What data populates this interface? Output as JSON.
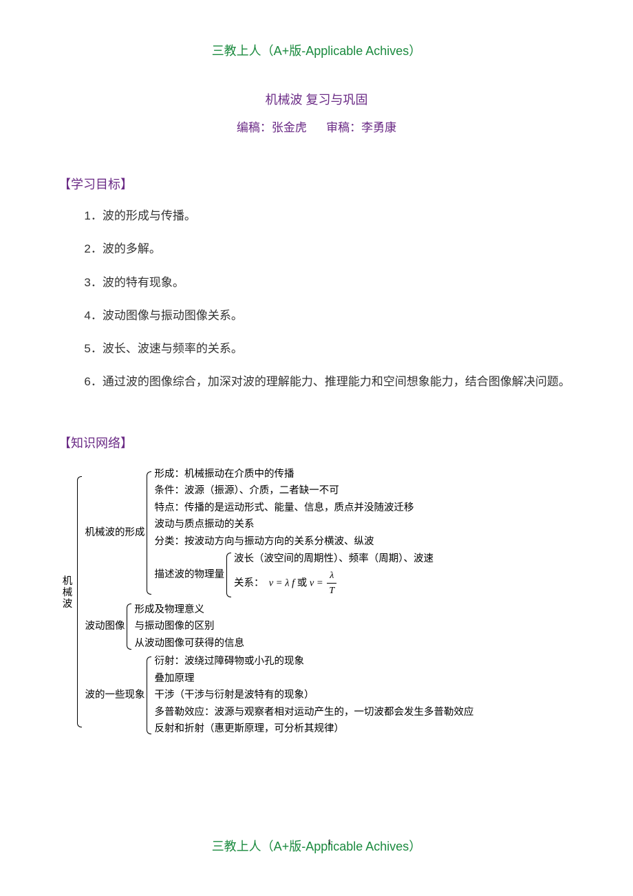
{
  "header": {
    "mark": "三教上人（A+版-Applicable Achives）"
  },
  "footer": {
    "mark_prefix": "三教上人（A+版-App",
    "mark_suffix": "licable Achives）",
    "page_num": "1"
  },
  "title": "机械波 复习与巩固",
  "author": {
    "label1": "编稿：",
    "name1": "张金虎",
    "label2": "审稿：",
    "name2": "李勇康"
  },
  "section_goals_head": "【学习目标】",
  "goals": {
    "g1": "1．波的形成与传播。",
    "g2": "2．波的多解。",
    "g3": "3．波的特有现象。",
    "g4": "4．波动图像与振动图像关系。",
    "g5": "5．波长、波速与频率的关系。",
    "g6": "6．通过波的图像综合，加深对波的理解能力、推理能力和空间想象能力，结合图像解决问题。"
  },
  "section_net_head": "【知识网络】",
  "net": {
    "root": "机械波",
    "b1": {
      "label": "机械波的形成",
      "l1": "形成：机械振动在介质中的传播",
      "l2": "条件：波源（振源）、介质，二者缺一不可",
      "l3": "特点：传播的是运动形式、能量、信息，质点并没随波迁移",
      "l4": "波动与质点振动的关系",
      "l5": "分类：按波动方向与振动方向的关系分横波、纵波",
      "b1_6": {
        "label": "描述波的物理量",
        "l1": "波长（波空间的周期性）、频率（周期）、波速",
        "l2_pre": "关系：",
        "f1_left": "v = λ f",
        "mid": " 或 ",
        "f2_v": "v =",
        "f2_num": "λ",
        "f2_den": "T"
      }
    },
    "b2": {
      "label": "波动图像",
      "l1": "形成及物理意义",
      "l2": "与振动图像的区别",
      "l3": "从波动图像可获得的信息"
    },
    "b3": {
      "label": "波的一些现象",
      "l1": "衍射：波绕过障碍物或小孔的现象",
      "l2": "叠加原理",
      "l3": "干涉（干涉与衍射是波特有的现象）",
      "l4": "多普勒效应：波源与观察者相对运动产生的，一切波都会发生多普勒效应",
      "l5": "反射和折射（惠更斯原理，可分析其规律）"
    }
  }
}
